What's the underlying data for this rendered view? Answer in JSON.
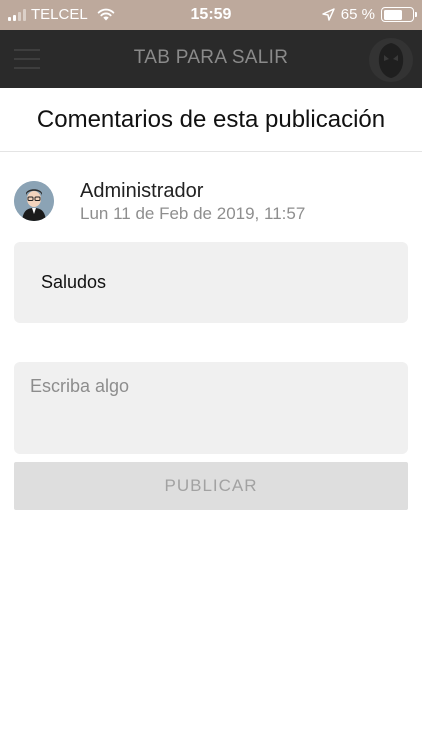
{
  "status_bar": {
    "carrier": "TELCEL",
    "time": "15:59",
    "battery_percent": "65 %",
    "battery_level": 0.65,
    "icons": [
      "signal-icon",
      "wifi-icon",
      "location-arrow-icon",
      "battery-icon"
    ]
  },
  "header": {
    "title": "TAB PARA SALIR",
    "icons": [
      "menu-icon",
      "logo-icon"
    ]
  },
  "page": {
    "title": "Comentarios de esta publicación"
  },
  "comment": {
    "author": "Administrador",
    "timestamp": "Lun 11 de Feb de 2019, 11:57",
    "text": "Saludos"
  },
  "composer": {
    "placeholder": "Escriba algo",
    "value": "",
    "submit_label": "PUBLICAR"
  },
  "colors": {
    "status_bar": "#bda99c",
    "header": "#2a2a2a",
    "field_bg": "#f0f0f0",
    "button_bg": "#dedede"
  }
}
